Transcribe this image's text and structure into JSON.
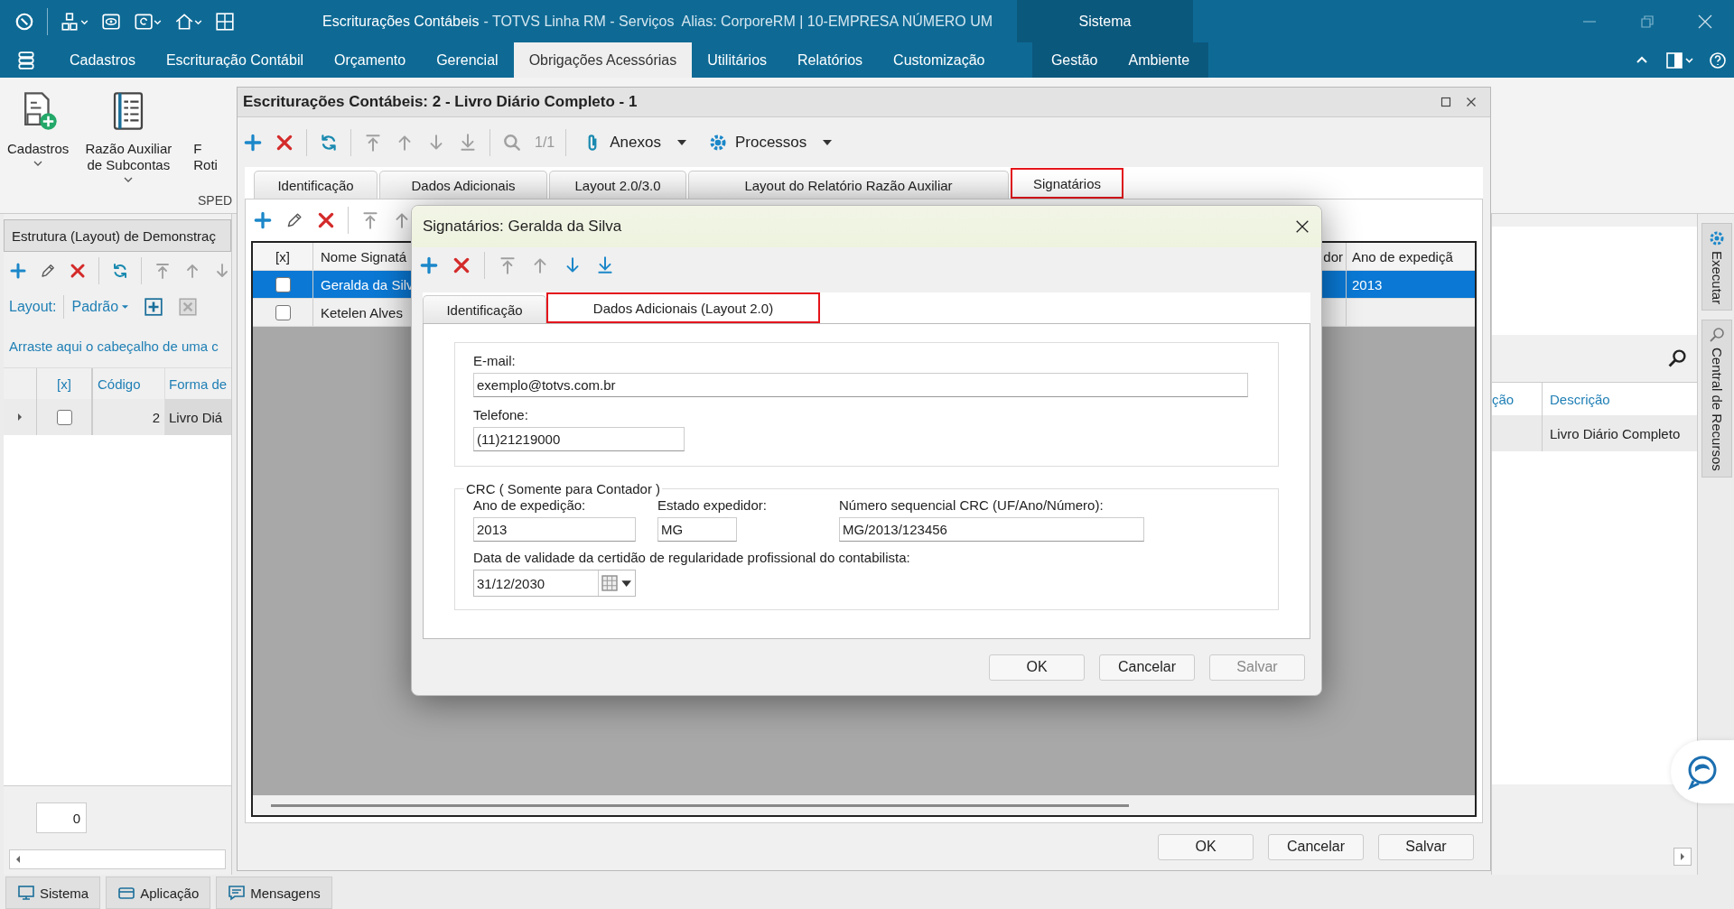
{
  "title_bar": {
    "title": "Escriturações Contábeis",
    "subtitle": "- TOTVS Linha RM - Serviços  Alias: CorporeRM | 10-EMPRESA NÚMERO UM",
    "context_tab": "Sistema"
  },
  "menu": [
    {
      "label": "Cadastros",
      "selected": false
    },
    {
      "label": "Escrituração Contábil",
      "selected": false
    },
    {
      "label": "Orçamento",
      "selected": false
    },
    {
      "label": "Gerencial",
      "selected": false
    },
    {
      "label": "Obrigações Acessórias",
      "selected": true
    },
    {
      "label": "Utilitários",
      "selected": false
    },
    {
      "label": "Relatórios",
      "selected": false
    },
    {
      "label": "Customização",
      "selected": false
    }
  ],
  "context_menu": [
    {
      "label": "Gestão",
      "selected": false
    },
    {
      "label": "Ambiente",
      "selected": false
    }
  ],
  "ribbon": {
    "buttons": [
      {
        "kind": "document-add",
        "lines": [
          "Cadastros"
        ],
        "dropdown": true
      },
      {
        "kind": "ledger",
        "lines": [
          "Razão Auxiliar",
          "de Subcontas"
        ],
        "dropdown": true
      },
      {
        "kind": "partial",
        "lines": [
          "F",
          "Roti"
        ],
        "dropdown": false
      }
    ],
    "group_label": "SPED"
  },
  "left_panel": {
    "title": "Estrutura (Layout) de Demonstraç",
    "layout_label": "Layout:",
    "layout_value": "Padrão",
    "group_hint": "Arraste aqui o cabeçalho de uma c",
    "columns": [
      "[x]",
      "Código",
      "Forma de"
    ],
    "rows": [
      {
        "checked": false,
        "code": "2",
        "form": "Livro Diá"
      }
    ],
    "footer_count": "0"
  },
  "right_panel": {
    "columns": [
      "ção",
      "Descrição"
    ],
    "rows": [
      {
        "description": "Livro Diário Completo"
      }
    ]
  },
  "side_tabs": [
    "Executar",
    "Central de Recursos"
  ],
  "status_tabs": [
    "Sistema",
    "Aplicação",
    "Mensagens"
  ],
  "main_window": {
    "title": "Escriturações Contábeis: 2 - Livro Diário Completo - 1",
    "counter": "1/1",
    "attachments": "Anexos",
    "processes": "Processos",
    "tabs": [
      {
        "label": "Identificação",
        "selected": false,
        "highlighted": false
      },
      {
        "label": "Dados Adicionais",
        "selected": false,
        "highlighted": false
      },
      {
        "label": "Layout 2.0/3.0",
        "selected": false,
        "highlighted": false
      },
      {
        "label": "Layout do Relatório Razão Auxiliar",
        "selected": false,
        "highlighted": false
      },
      {
        "label": "Signatários",
        "selected": true,
        "highlighted": true
      }
    ],
    "grid": {
      "columns": [
        "[x]",
        "Nome Signatá",
        "dor",
        "Ano de expediçã"
      ],
      "rows": [
        {
          "selected": true,
          "checked": false,
          "name": "Geralda da Silv",
          "year": "2013"
        },
        {
          "selected": false,
          "checked": false,
          "name": "Ketelen Alves"
        }
      ]
    },
    "buttons": [
      {
        "label": "OK",
        "disabled": false
      },
      {
        "label": "Cancelar",
        "disabled": false
      },
      {
        "label": "Salvar",
        "disabled": false
      }
    ]
  },
  "dialog": {
    "title": "Signatários: Geralda da Silva",
    "tabs": [
      {
        "label": "Identificação",
        "selected": false,
        "highlighted": false
      },
      {
        "label": "Dados Adicionais (Layout 2.0)",
        "selected": true,
        "highlighted": true
      }
    ],
    "email": {
      "label": "E-mail:",
      "value": "exemplo@totvs.com.br"
    },
    "phone": {
      "label": "Telefone:",
      "value": "(11)21219000"
    },
    "crc": {
      "title": "CRC ( Somente para Contador )",
      "year": {
        "label": "Ano de expedição:",
        "value": "2013"
      },
      "state": {
        "label": "Estado expedidor:",
        "value": "MG"
      },
      "number": {
        "label": "Número sequencial CRC (UF/Ano/Número):",
        "value": "MG/2013/123456"
      },
      "validity": {
        "label": "Data de validade da certidão de regularidade profissional do contabilista:",
        "value": "31/12/2030"
      }
    },
    "buttons": [
      {
        "label": "OK",
        "disabled": false
      },
      {
        "label": "Cancelar",
        "disabled": false
      },
      {
        "label": "Salvar",
        "disabled": true
      }
    ]
  }
}
